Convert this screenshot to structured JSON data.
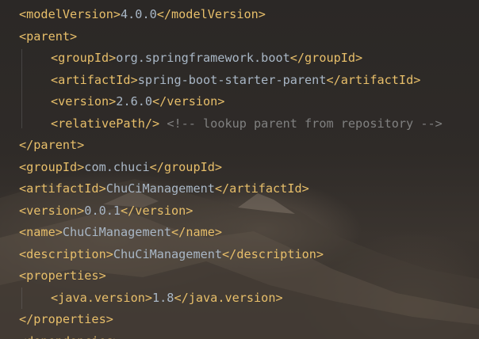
{
  "editor": {
    "lines": [
      {
        "indent": 0,
        "segments": [
          {
            "t": "tag",
            "v": "<modelVersion>"
          },
          {
            "t": "text",
            "v": "4.0.0"
          },
          {
            "t": "tag",
            "v": "</modelVersion>"
          }
        ]
      },
      {
        "indent": 0,
        "segments": [
          {
            "t": "tag",
            "v": "<parent>"
          }
        ]
      },
      {
        "indent": 1,
        "segments": [
          {
            "t": "tag",
            "v": "<groupId>"
          },
          {
            "t": "text",
            "v": "org.springframework.boot"
          },
          {
            "t": "tag",
            "v": "</groupId>"
          }
        ]
      },
      {
        "indent": 1,
        "segments": [
          {
            "t": "tag",
            "v": "<artifactId>"
          },
          {
            "t": "text",
            "v": "spring-boot-starter-parent"
          },
          {
            "t": "tag",
            "v": "</artifactId>"
          }
        ]
      },
      {
        "indent": 1,
        "segments": [
          {
            "t": "tag",
            "v": "<version>"
          },
          {
            "t": "text",
            "v": "2.6.0"
          },
          {
            "t": "tag",
            "v": "</version>"
          }
        ]
      },
      {
        "indent": 1,
        "segments": [
          {
            "t": "tag",
            "v": "<relativePath/>"
          },
          {
            "t": "text",
            "v": " "
          },
          {
            "t": "comment",
            "v": "<!-- lookup parent from repository -->"
          }
        ]
      },
      {
        "indent": 0,
        "segments": [
          {
            "t": "tag",
            "v": "</parent>"
          }
        ]
      },
      {
        "indent": 0,
        "segments": [
          {
            "t": "tag",
            "v": "<groupId>"
          },
          {
            "t": "text",
            "v": "com.chuci"
          },
          {
            "t": "tag",
            "v": "</groupId>"
          }
        ]
      },
      {
        "indent": 0,
        "segments": [
          {
            "t": "tag",
            "v": "<artifactId>"
          },
          {
            "t": "text",
            "v": "ChuCiManagement"
          },
          {
            "t": "tag",
            "v": "</artifactId>"
          }
        ]
      },
      {
        "indent": 0,
        "segments": [
          {
            "t": "tag",
            "v": "<version>"
          },
          {
            "t": "text",
            "v": "0.0.1"
          },
          {
            "t": "tag",
            "v": "</version>"
          }
        ]
      },
      {
        "indent": 0,
        "segments": [
          {
            "t": "tag",
            "v": "<name>"
          },
          {
            "t": "text",
            "v": "ChuCiManagement"
          },
          {
            "t": "tag",
            "v": "</name>"
          }
        ]
      },
      {
        "indent": 0,
        "segments": [
          {
            "t": "tag",
            "v": "<description>"
          },
          {
            "t": "text",
            "v": "ChuCiManagement"
          },
          {
            "t": "tag",
            "v": "</description>"
          }
        ]
      },
      {
        "indent": 0,
        "segments": [
          {
            "t": "tag",
            "v": "<properties>"
          }
        ]
      },
      {
        "indent": 1,
        "segments": [
          {
            "t": "tag",
            "v": "<java.version>"
          },
          {
            "t": "text",
            "v": "1.8"
          },
          {
            "t": "tag",
            "v": "</java.version>"
          }
        ]
      },
      {
        "indent": 0,
        "segments": [
          {
            "t": "tag",
            "v": "</properties>"
          }
        ]
      },
      {
        "indent": 0,
        "segments": [
          {
            "t": "tag",
            "v": "<dependencies>"
          }
        ]
      }
    ]
  },
  "colors": {
    "tag": "#e8bf6a",
    "text": "#a9b7c6",
    "comment": "#808080"
  }
}
